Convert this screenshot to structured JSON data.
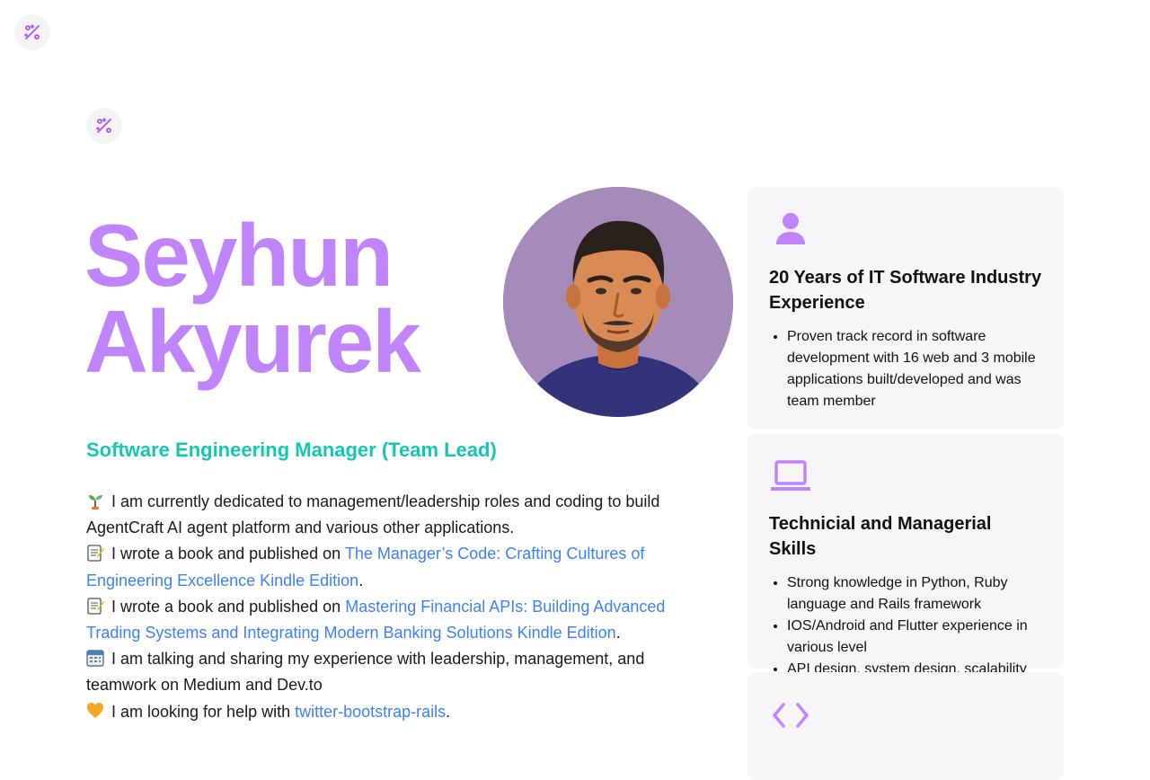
{
  "colors": {
    "accent_purple": "#c084fc",
    "accent_teal": "#14c7b0",
    "link_blue": "#3b82f6",
    "card_bg": "#f6f6f8"
  },
  "header": {
    "logo_icon": "sparkle-percent-icon"
  },
  "hero": {
    "name_first": "Seyhun",
    "name_last": "Akyurek",
    "role": "Software Engineering Manager (Team Lead)",
    "avatar_icon": "profile-photo"
  },
  "bio": [
    {
      "icon": "seedling-icon",
      "text": "I am currently dedicated to management/leadership roles and coding to build AgentCraft AI agent platform and various other applications."
    },
    {
      "icon": "memo-icon",
      "prefix": "I wrote a book and published on ",
      "link": "The Manager’s Code: Crafting Cultures of Engineering Excellence Kindle Edition",
      "suffix": "."
    },
    {
      "icon": "memo-icon",
      "prefix": "I wrote a book and published on ",
      "link": "Mastering Financial APIs: Building Advanced Trading Systems and Integrating Modern Banking Solutions Kindle Edition",
      "suffix": "."
    },
    {
      "icon": "calendar-icon",
      "text": "I am talking and sharing my experience with leadership, management, and teamwork on Medium and Dev.to"
    },
    {
      "icon": "heart-icon",
      "prefix": "I am looking for help with ",
      "link": "twitter-bootstrap-rails",
      "suffix": "."
    }
  ],
  "cards": [
    {
      "icon": "user-icon",
      "title": "20 Years of IT Software Industry Experience",
      "items": [
        "Proven track record in software development with 16 web and 3 mobile applications built/developed and was team member"
      ]
    },
    {
      "icon": "laptop-icon",
      "title": "Technicial and Managerial Skills",
      "items": [
        "Strong knowledge in Python, Ruby language and Rails framework",
        "IOS/Android and Flutter experience in various level",
        "API design, system design, scalability"
      ]
    },
    {
      "icon": "code-icon"
    }
  ]
}
